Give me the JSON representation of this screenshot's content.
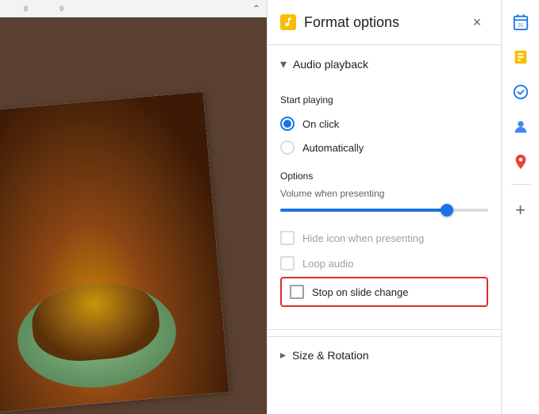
{
  "panel": {
    "title": "Format options",
    "icon": "🎵",
    "close_label": "×"
  },
  "audio_playback": {
    "section_label": "Audio playback",
    "start_playing_label": "Start playing",
    "on_click_label": "On click",
    "automatically_label": "Automatically",
    "options_label": "Options",
    "volume_label": "Volume when presenting",
    "slider_value": 80,
    "hide_icon_label": "Hide icon when presenting",
    "loop_audio_label": "Loop audio",
    "stop_on_change_label": "Stop on slide change"
  },
  "size_rotation": {
    "label": "Size & Rotation"
  },
  "ruler": {
    "marks": [
      "8",
      "9"
    ]
  },
  "sidebar": {
    "icons": [
      {
        "name": "calendar-icon",
        "glyph": "📅",
        "color": "#1a73e8"
      },
      {
        "name": "notes-icon",
        "glyph": "🟡",
        "color": "#fbbc04"
      },
      {
        "name": "tasks-icon",
        "glyph": "✔",
        "color": "#1a73e8"
      },
      {
        "name": "contacts-icon",
        "glyph": "👤",
        "color": "#4285f4"
      },
      {
        "name": "maps-icon",
        "glyph": "📍",
        "color": "#ea4335"
      }
    ],
    "add_label": "+"
  }
}
